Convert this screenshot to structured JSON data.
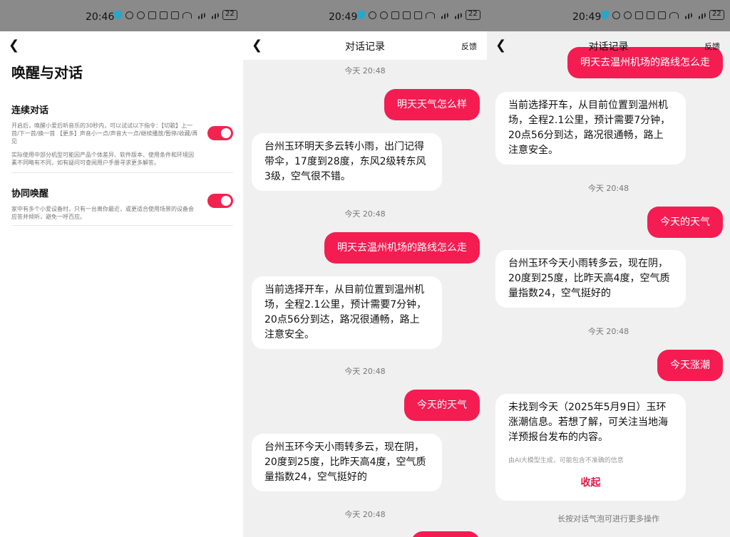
{
  "panel1": {
    "status_time": "20:46",
    "battery": "22",
    "title": "唤醒与对话",
    "continuous": {
      "title": "连续对话",
      "desc": "开启后，唤醒小爱后听音乐的30秒内，可以试试以下指令：【切歌】上一首/下一首/换一首 【更多】声音小一点/声音大一点/继续播放/暂停/收藏/再见",
      "note": "实际使用中部分机型可能因产品个体差异、软件版本、使用条件和环境因素不同略有不同，如有疑问可查阅用户手册寻求更多解答。"
    },
    "cowake": {
      "title": "协同唤醒",
      "desc": "家中有多个小爱设备时，只有一台离你最近，或更适合使用场景的设备会应答并倾听，避免一呼百应。"
    }
  },
  "panel2": {
    "status_time": "20:49",
    "battery": "22",
    "title": "对话记录",
    "feedback": "反馈",
    "ts": "今天 20:48",
    "q1": "明天天气怎么样",
    "a1": "台州玉环明天多云转小雨，出门记得带伞，17度到28度，东风2级转东风3级，空气很不错。",
    "q2": "明天去温州机场的路线怎么走",
    "a2": "当前选择开车，从目前位置到温州机场，全程2.1公里，预计需要7分钟，20点56分到达，路况很通畅，路上注意安全。",
    "q3": "今天的天气",
    "a3": "台州玉环今天小雨转多云，现在阴，20度到25度，比昨天高4度，空气质量指数24，空气挺好的"
  },
  "panel3": {
    "status_time": "20:49",
    "battery": "22",
    "title": "对话记录",
    "feedback": "反馈",
    "ts": "今天 20:48",
    "q_top": "明天去温州机场的路线怎么走",
    "a1": "当前选择开车，从目前位置到温州机场，全程2.1公里，预计需要7分钟，20点56分到达，路况很通畅，路上注意安全。",
    "q2": "今天的天气",
    "a2": "台州玉环今天小雨转多云，现在阴，20度到25度，比昨天高4度，空气质量指数24，空气挺好的",
    "q3": "今天涨潮",
    "a3": "未找到今天（2025年5月9日）玉环涨潮信息。若想了解，可关注当地海洋预报台发布的内容。",
    "ai_note": "由AI大模型生成，可能包含不准确的信息",
    "collapse": "收起",
    "hint": "长按对话气泡可进行更多操作"
  }
}
